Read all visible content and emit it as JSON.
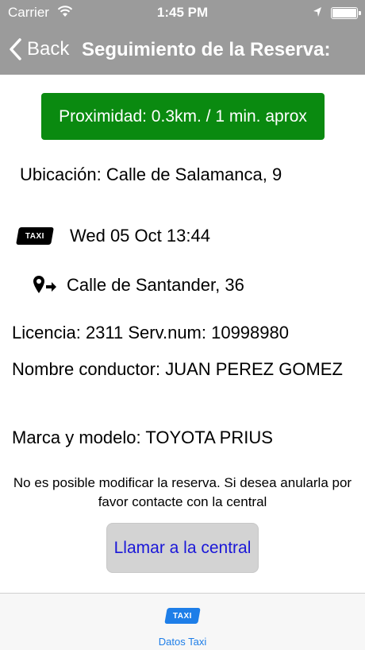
{
  "status_bar": {
    "carrier": "Carrier",
    "time": "1:45 PM",
    "icons": [
      "wifi-icon",
      "location-arrow-icon",
      "battery-icon"
    ]
  },
  "nav": {
    "back_label": "Back",
    "title": "Seguimiento de la Reserva:"
  },
  "colors": {
    "nav_background": "#9b9b9b",
    "proximity_background": "#0a8a10",
    "call_button_background": "#d3d3d3",
    "call_button_text": "#1a17d8",
    "tab_accent": "#1e7ee8"
  },
  "booking": {
    "proximity": "Proximidad: 0.3km. / 1 min. aprox",
    "ubicacion": "Ubicación: Calle de Salamanca, 9",
    "taxi_badge": "TAXI",
    "datetime": "Wed 05 Oct 13:44",
    "destination": "Calle de Santander, 36",
    "licencia": "Licencia: 2311  Serv.num: 10998980",
    "conductor": "Nombre conductor: JUAN PEREZ GOMEZ",
    "marca": "Marca y modelo: TOYOTA PRIUS",
    "notice": "No es posible modificar la reserva. Si desea anularla por favor contacte con la central"
  },
  "actions": {
    "call_label": "Llamar a la central"
  },
  "tab_bar": {
    "items": [
      {
        "icon_text": "TAXI",
        "label": "Datos Taxi"
      }
    ]
  }
}
